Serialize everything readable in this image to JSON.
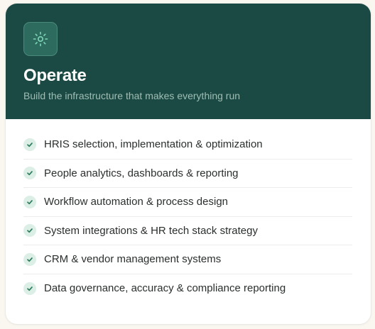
{
  "card": {
    "icon": "sun-gear-icon",
    "title": "Operate",
    "subtitle": "Build the infrastructure that makes everything run",
    "colors": {
      "header_bg": "#1b4a44",
      "icon_accent": "#7fd6b8",
      "check_bg": "#dcefe6",
      "check_mark": "#2f7d5e"
    }
  },
  "items": [
    {
      "label": "HRIS selection, implementation & optimization",
      "icon": "check-icon"
    },
    {
      "label": "People analytics, dashboards & reporting",
      "icon": "check-icon"
    },
    {
      "label": "Workflow automation & process design",
      "icon": "check-icon"
    },
    {
      "label": "System integrations & HR tech stack strategy",
      "icon": "check-icon"
    },
    {
      "label": "CRM & vendor management systems",
      "icon": "check-icon"
    },
    {
      "label": "Data governance, accuracy & compliance reporting",
      "icon": "check-icon"
    }
  ]
}
